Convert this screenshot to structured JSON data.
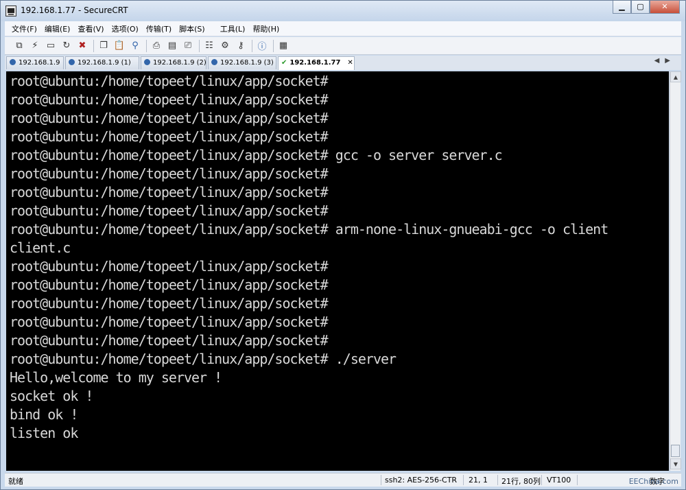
{
  "window": {
    "title": "192.168.1.77 - SecureCRT"
  },
  "menu": [
    "文件(F)",
    "编辑(E)",
    "查看(V)",
    "选项(O)",
    "传输(T)",
    "脚本(S)",
    "工具(L)",
    "帮助(H)"
  ],
  "toolbar": {
    "icons": [
      "connect-icon",
      "quick-connect-icon",
      "connect-tab-icon",
      "reconnect-icon",
      "disconnect-icon",
      "copy-icon",
      "paste-icon",
      "find-icon",
      "print-icon",
      "print-setup-icon",
      "print-screen-icon",
      "session-options-icon",
      "global-options-icon",
      "keymap-icon",
      "help-icon",
      "log-icon"
    ]
  },
  "tabs": [
    {
      "label": "192.168.1.9"
    },
    {
      "label": "192.168.1.9 (1)"
    },
    {
      "label": "192.168.1.9 (2)"
    },
    {
      "label": "192.168.1.9 (3)"
    },
    {
      "label": "192.168.1.77",
      "active": true
    }
  ],
  "terminal": {
    "lines": [
      "root@ubuntu:/home/topeet/linux/app/socket#",
      "root@ubuntu:/home/topeet/linux/app/socket#",
      "root@ubuntu:/home/topeet/linux/app/socket#",
      "root@ubuntu:/home/topeet/linux/app/socket#",
      "root@ubuntu:/home/topeet/linux/app/socket# gcc -o server server.c",
      "root@ubuntu:/home/topeet/linux/app/socket#",
      "root@ubuntu:/home/topeet/linux/app/socket#",
      "root@ubuntu:/home/topeet/linux/app/socket#",
      "root@ubuntu:/home/topeet/linux/app/socket# arm-none-linux-gnueabi-gcc -o client",
      "client.c",
      "root@ubuntu:/home/topeet/linux/app/socket#",
      "root@ubuntu:/home/topeet/linux/app/socket#",
      "root@ubuntu:/home/topeet/linux/app/socket#",
      "root@ubuntu:/home/topeet/linux/app/socket#",
      "root@ubuntu:/home/topeet/linux/app/socket#",
      "root@ubuntu:/home/topeet/linux/app/socket# ./server",
      "Hello,welcome to my server !",
      "socket ok !",
      "bind ok !",
      "listen ok"
    ]
  },
  "status": {
    "ready": "就绪",
    "cipher": "ssh2: AES-256-CTR",
    "cursor": "21,  1",
    "size": "21行, 80列",
    "emulation": "VT100",
    "caps": "数字"
  },
  "watermark": "EEChina.com"
}
